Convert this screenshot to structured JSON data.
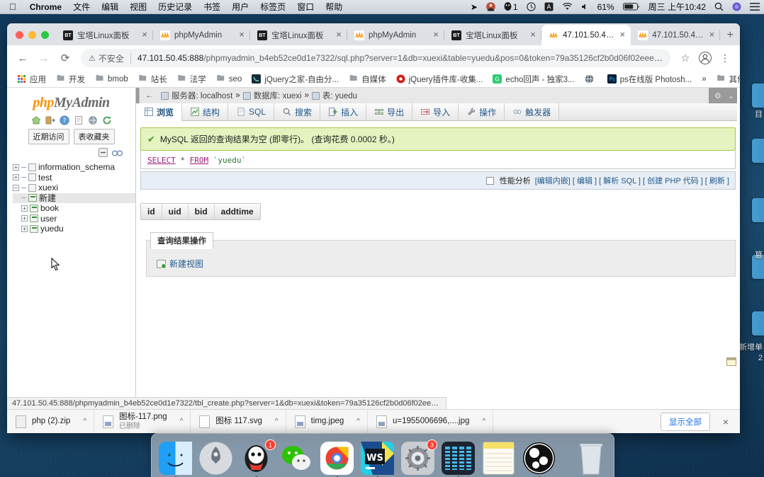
{
  "menubar": {
    "apple_icon": "apple-icon",
    "items": [
      {
        "label": "Chrome",
        "bold": true
      },
      {
        "label": "文件"
      },
      {
        "label": "编辑"
      },
      {
        "label": "视图"
      },
      {
        "label": "历史记录"
      },
      {
        "label": "书签"
      },
      {
        "label": "用户"
      },
      {
        "label": "标签页"
      },
      {
        "label": "窗口"
      },
      {
        "label": "帮助"
      }
    ],
    "status": {
      "qq_badge": "1",
      "battery_percent": "61%",
      "datetime": "周三 上午10:42",
      "icons": [
        "send-icon",
        "user-avatar-icon",
        "qq-penguin-icon",
        "time-machine-icon",
        "input-source-icon",
        "wifi-icon",
        "volume-icon",
        "battery-icon",
        "search-icon",
        "control-center-icon"
      ]
    }
  },
  "browser": {
    "tabs": [
      {
        "title": "宝塔Linux面板",
        "favicon": "bt-icon",
        "active": false
      },
      {
        "title": "phpMyAdmin",
        "favicon": "pma-icon",
        "active": false
      },
      {
        "title": "宝塔Linux面板",
        "favicon": "bt-icon",
        "active": false
      },
      {
        "title": "phpMyAdmin",
        "favicon": "pma-icon",
        "active": false
      },
      {
        "title": "宝塔Linux面板",
        "favicon": "bt-icon",
        "active": false
      },
      {
        "title": "47.101.50.45:888",
        "favicon": "pma-icon",
        "active": true
      },
      {
        "title": "47.101.50.45:888",
        "favicon": "pma-icon",
        "active": false
      }
    ],
    "new_tab_label": "+",
    "close_label": "×",
    "nav": {
      "back": "←",
      "forward": "→",
      "reload": "⟳"
    },
    "omnibox": {
      "security_label": "不安全",
      "security_icon": "warning-triangle-icon",
      "url_host": "47.101.50.45:888",
      "url_path": "/phpmyadmin_b4eb52ce0d1e7322/sql.php?server=1&db=xuexi&table=yuedu&pos=0&token=79a35126cf2b0d06f02eee73c7e83aaf"
    },
    "toolbar_icons": [
      "bookmark-star-icon",
      "profile-avatar-icon",
      "chrome-menu-icon"
    ],
    "bookmarks": [
      {
        "label": "应用",
        "icon": "apps-grid-icon"
      },
      {
        "label": "开发",
        "icon": "folder-icon"
      },
      {
        "label": "bmob",
        "icon": "folder-icon"
      },
      {
        "label": "站长",
        "icon": "folder-icon"
      },
      {
        "label": "法学",
        "icon": "folder-icon"
      },
      {
        "label": "seo",
        "icon": "folder-icon"
      },
      {
        "label": "jQuery之家-自由分...",
        "icon": "jquery-site-icon"
      },
      {
        "label": "自媒体",
        "icon": "folder-icon"
      },
      {
        "label": "jQuery插件库-收集...",
        "icon": "jquery-plugin-icon"
      },
      {
        "label": "echo回声 - 独家3...",
        "icon": "echo-icon"
      },
      {
        "label": "",
        "icon": "globe-icon"
      },
      {
        "label": "ps在线版 Photosh...",
        "icon": "ps-icon"
      }
    ],
    "bookmarks_overflow": "»",
    "other_bookmarks": {
      "label": "其他书签",
      "icon": "folder-icon"
    },
    "status_url": "47.101.50.45:888/phpmyadmin_b4eb52ce0d1e7322/tbl_create.php?server=1&db=xuexi&token=79a35126cf2b0d06f02eee73c7e83aaf"
  },
  "pma": {
    "logo": {
      "part1": "php",
      "part2": "MyAdmin"
    },
    "header_icons": [
      "home-icon",
      "exit-icon",
      "docs-icon",
      "sql-docs-icon",
      "settings-globe-icon",
      "reload-icon"
    ],
    "chips": [
      "近期访问",
      "表收藏夹"
    ],
    "tree_tools": [
      "collapse-all-icon",
      "link-tables-icon"
    ],
    "tree": [
      {
        "label": "information_schema",
        "type": "database",
        "expanded": false,
        "indent": 0
      },
      {
        "label": "test",
        "type": "database",
        "expanded": false,
        "indent": 0
      },
      {
        "label": "xuexi",
        "type": "database",
        "expanded": true,
        "indent": 0
      },
      {
        "label": "新建",
        "type": "new",
        "indent": 1,
        "selected": true
      },
      {
        "label": "book",
        "type": "table",
        "indent": 1
      },
      {
        "label": "user",
        "type": "table",
        "indent": 1
      },
      {
        "label": "yuedu",
        "type": "table",
        "indent": 1
      }
    ],
    "breadcrumb": {
      "back_arrow": "←",
      "server_label": "服务器: localhost",
      "db_label": "数据库: xuexi",
      "table_label": "表: yuedu",
      "sep": "»"
    },
    "window_buttons": [
      "gear-icon",
      "collapse-icon"
    ],
    "tabs": [
      {
        "label": "浏览",
        "icon": "browse-icon",
        "active": true
      },
      {
        "label": "结构",
        "icon": "structure-icon",
        "active": false
      },
      {
        "label": "SQL",
        "icon": "sql-icon",
        "active": false
      },
      {
        "label": "搜索",
        "icon": "search-icon",
        "active": false
      },
      {
        "label": "插入",
        "icon": "insert-icon",
        "active": false
      },
      {
        "label": "导出",
        "icon": "export-icon",
        "active": false
      },
      {
        "label": "导入",
        "icon": "import-icon",
        "active": false
      },
      {
        "label": "操作",
        "icon": "operations-wrench-icon",
        "active": false
      },
      {
        "label": "触发器",
        "icon": "triggers-icon",
        "active": false
      }
    ],
    "result_banner": "MySQL 返回的查询结果为空 (即零行)。 (查询花费 0.0002 秒。)",
    "sql": {
      "keyword1": "SELECT",
      "star": "*",
      "keyword2": "FROM",
      "table": "`yuedu`"
    },
    "sql_actions": {
      "profiling_label": "性能分析",
      "links": [
        "[编辑内嵌]",
        "[ 编辑 ]",
        "[ 解析 SQL ]",
        "[ 创建 PHP 代码 ]",
        "[ 刷新 ]"
      ]
    },
    "result_columns": [
      "id",
      "uid",
      "bid",
      "addtime"
    ],
    "query_ops": {
      "legend": "查询结果操作",
      "create_view_label": "新建视图",
      "create_view_icon": "create-view-icon"
    }
  },
  "downloads": {
    "items": [
      {
        "name": "php (2).zip",
        "sub": "",
        "icon": "zip-file-icon"
      },
      {
        "name": "图标-117.png",
        "sub": "已删除",
        "icon": "image-file-icon"
      },
      {
        "name": "图标 117.svg",
        "sub": "",
        "icon": "svg-file-icon"
      },
      {
        "name": "timg.jpeg",
        "sub": "",
        "icon": "image-file-icon"
      },
      {
        "name": "u=1955006696,....jpg",
        "sub": "",
        "icon": "image-file-icon"
      }
    ],
    "caret": "^",
    "show_all_label": "显示全部",
    "close_label": "×"
  },
  "dock": {
    "items": [
      {
        "name": "finder",
        "badge": null,
        "running": true
      },
      {
        "name": "launchpad",
        "badge": null,
        "running": false
      },
      {
        "name": "qq",
        "badge": "1",
        "running": true
      },
      {
        "name": "wechat",
        "badge": null,
        "running": false
      },
      {
        "name": "chrome",
        "badge": null,
        "running": true
      },
      {
        "name": "webstorm",
        "badge": null,
        "running": true
      },
      {
        "name": "system-preferences",
        "badge": "3",
        "running": false
      },
      {
        "name": "activity-monitor",
        "badge": null,
        "running": true
      },
      {
        "name": "notes",
        "badge": null,
        "running": false
      },
      {
        "name": "obs",
        "badge": null,
        "running": true
      },
      {
        "name": "trash",
        "badge": null,
        "running": false
      }
    ]
  },
  "desktop": {
    "labels": [
      "目",
      "篡",
      "新增单",
      "2"
    ]
  }
}
